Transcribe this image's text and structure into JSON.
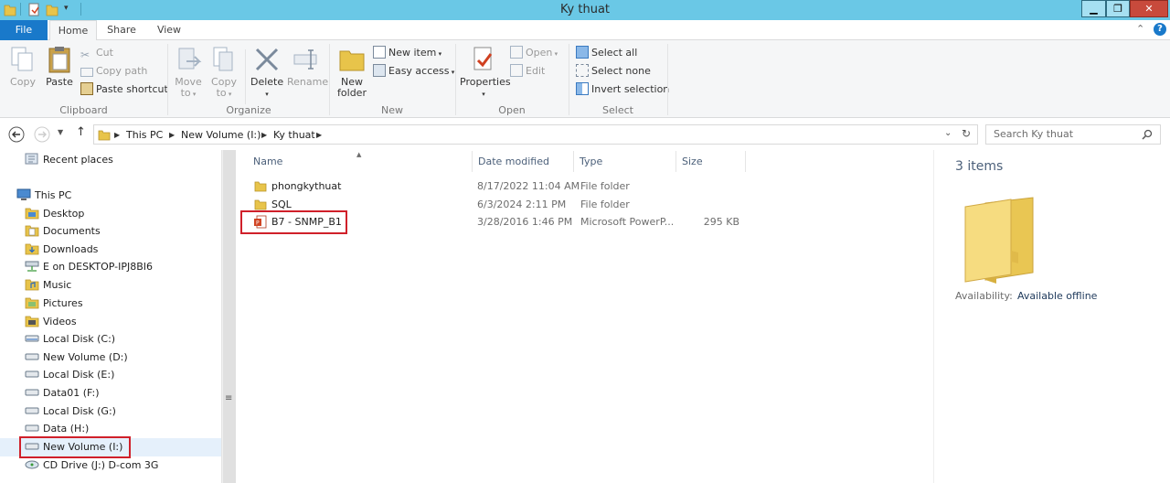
{
  "window": {
    "title": "Ky thuat",
    "minimize": "▁",
    "restore": "❐",
    "close": "✕"
  },
  "tabs": [
    {
      "label": "File"
    },
    {
      "label": "Home"
    },
    {
      "label": "Share"
    },
    {
      "label": "View"
    }
  ],
  "ribbon": {
    "clipboard": {
      "label": "Clipboard",
      "copy": "Copy",
      "paste": "Paste",
      "cut": "Cut",
      "copy_path": "Copy path",
      "paste_shortcut": "Paste shortcut"
    },
    "organize": {
      "label": "Organize",
      "move_to": "Move",
      "move_to2": "to",
      "copy_to": "Copy",
      "copy_to2": "to",
      "delete": "Delete",
      "rename": "Rename"
    },
    "new": {
      "label": "New",
      "new_folder": "New",
      "new_folder2": "folder",
      "new_item": "New item",
      "easy_access": "Easy access"
    },
    "open": {
      "label": "Open",
      "properties": "Properties",
      "open": "Open",
      "edit": "Edit"
    },
    "select": {
      "label": "Select",
      "select_all": "Select all",
      "select_none": "Select none",
      "invert": "Invert selection"
    }
  },
  "address": {
    "crumbs": [
      "This PC",
      "New Volume (I:)",
      "Ky thuat"
    ],
    "search_placeholder": "Search Ky thuat"
  },
  "nav": {
    "items": [
      {
        "label": "Recent places",
        "icon": "recent-places-icon"
      },
      {
        "label": "This PC",
        "icon": "computer-icon"
      },
      {
        "label": "Desktop",
        "icon": "desktop-icon"
      },
      {
        "label": "Documents",
        "icon": "documents-icon"
      },
      {
        "label": "Downloads",
        "icon": "downloads-icon"
      },
      {
        "label": "E on DESKTOP-IPJ8BI6",
        "icon": "network-drive-icon"
      },
      {
        "label": "Music",
        "icon": "music-icon"
      },
      {
        "label": "Pictures",
        "icon": "pictures-icon"
      },
      {
        "label": "Videos",
        "icon": "videos-icon"
      },
      {
        "label": "Local Disk (C:)",
        "icon": "disk-icon"
      },
      {
        "label": "New Volume (D:)",
        "icon": "disk-icon"
      },
      {
        "label": "Local Disk (E:)",
        "icon": "disk-icon"
      },
      {
        "label": "Data01 (F:)",
        "icon": "disk-icon"
      },
      {
        "label": "Local Disk (G:)",
        "icon": "disk-icon"
      },
      {
        "label": "Data (H:)",
        "icon": "disk-icon"
      },
      {
        "label": "New Volume (I:)",
        "icon": "disk-icon"
      },
      {
        "label": "CD Drive (J:) D-com 3G",
        "icon": "cd-drive-icon"
      }
    ],
    "scroll_grip": "≡"
  },
  "columns": {
    "name": "Name",
    "date": "Date modified",
    "type": "Type",
    "size": "Size"
  },
  "files": [
    {
      "name": "phongkythuat",
      "date": "8/17/2022 11:04 AM",
      "type": "File folder",
      "size": "",
      "icon": "folder-icon"
    },
    {
      "name": "SQL",
      "date": "6/3/2024 2:11 PM",
      "type": "File folder",
      "size": "",
      "icon": "folder-icon"
    },
    {
      "name": "B7 - SNMP_B1",
      "date": "3/28/2016 1:46 PM",
      "type": "Microsoft PowerP...",
      "size": "295 KB",
      "icon": "powerpoint-icon"
    }
  ],
  "details": {
    "count": "3 items",
    "availability_label": "Availability:",
    "availability_value": "Available offline"
  },
  "colors": {
    "titlebar": "#6ac8e6",
    "file_tab": "#1979ca",
    "highlight": "#d0202a"
  }
}
